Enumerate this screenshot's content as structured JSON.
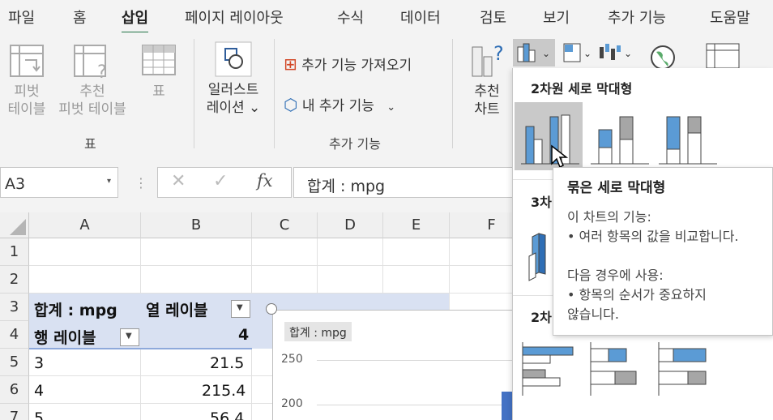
{
  "tabs": [
    "파일",
    "홈",
    "삽입",
    "페이지 레이아웃",
    "수식",
    "데이터",
    "검토",
    "보기",
    "추가 기능",
    "도움말"
  ],
  "active_tab": "삽입",
  "ribbon": {
    "pivot_table": "피벗\n테이블",
    "recommended_pivot": "추천\n피벗 테이블",
    "table": "표",
    "tables_group": "표",
    "illustrations": "일러스트\n레이션 ⌄",
    "get_addins": "추가 기능 가져오기",
    "my_addins": "내 추가 기능",
    "addins_group": "추가 기능",
    "recommended_charts": "추천\n차트"
  },
  "formula_bar": {
    "name_box": "A3",
    "formula": "합계 : mpg"
  },
  "grid": {
    "columns": [
      "A",
      "B",
      "C",
      "D",
      "E",
      "F"
    ],
    "rows": [
      "1",
      "2",
      "3",
      "4",
      "5",
      "6",
      "7"
    ],
    "a3": "합계 : mpg",
    "b3": "열 레이블",
    "a4": "행 레이블",
    "b4": "4",
    "data_rows": [
      {
        "a": "3",
        "b": "21.5"
      },
      {
        "a": "4",
        "b": "215.4"
      },
      {
        "a": "5",
        "b": "56.4"
      }
    ]
  },
  "chart": {
    "field_button": "합계 : mpg",
    "ticks": [
      "250",
      "200"
    ]
  },
  "dropdown": {
    "section_2d_column": "2차원 세로 막대형",
    "section_3d_partial": "3차",
    "section_2d_bar_partial": "2차"
  },
  "tooltip": {
    "title": "묶은 세로 막대형",
    "line1": "이 차트의 기능:",
    "line2": "• 여러 항목의 값을 비교합니다.",
    "line3": "다음 경우에 사용:",
    "line4": "• 항목의 순서가 중요하지",
    "line5": "않습니다."
  },
  "colors": {
    "accent_green": "#217346",
    "pivot_header": "#d9e1f2",
    "chart_blue": "#5b9bd5",
    "chart_gray": "#a6a6a6"
  }
}
